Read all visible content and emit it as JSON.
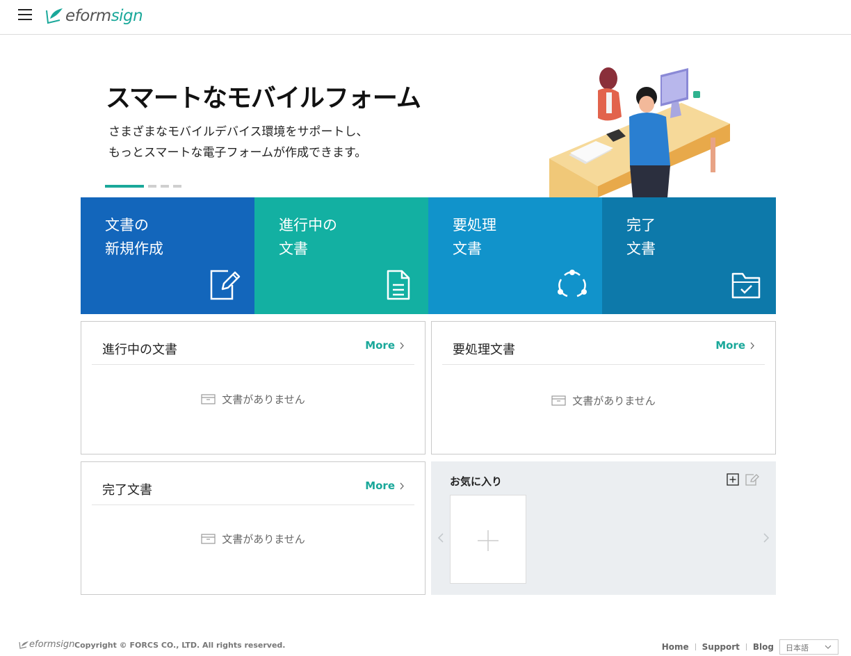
{
  "header": {
    "logo_text_e": "eform",
    "logo_text_sign": "sign"
  },
  "banner": {
    "title": "スマートなモバイルフォーム",
    "subtitle_line1": "さまざまなモバイルデバイス環境をサポートし、",
    "subtitle_line2": "もっとスマートな電子フォームが作成できます。",
    "slide_count": 4,
    "active_slide": 1
  },
  "tiles": [
    {
      "line1": "文書の",
      "line2": "新規作成",
      "icon": "edit-document-icon",
      "color": "#1366bb"
    },
    {
      "line1": "進行中の",
      "line2": "文書",
      "icon": "document-icon",
      "color": "#13b0a2"
    },
    {
      "line1": "要処理",
      "line2": "文書",
      "icon": "workflow-cycle-icon",
      "color": "#1193cb"
    },
    {
      "line1": "完了",
      "line2": "文書",
      "icon": "folder-check-icon",
      "color": "#0d79aa"
    }
  ],
  "panels": {
    "in_progress": {
      "title": "進行中の文書",
      "more": "More",
      "empty": "文書がありません"
    },
    "action_required": {
      "title": "要処理文書",
      "more": "More",
      "empty": "文書がありません"
    },
    "completed": {
      "title": "完了文書",
      "more": "More",
      "empty": "文書がありません"
    }
  },
  "favorites": {
    "title": "お気に入り"
  },
  "footer": {
    "logo_text": "eformsign",
    "copyright": "Copyright © FORCS CO., LTD. All rights reserved.",
    "links": [
      "Home",
      "Support",
      "Blog"
    ],
    "language": "日本語"
  },
  "colors": {
    "accent": "#1aa89a"
  }
}
